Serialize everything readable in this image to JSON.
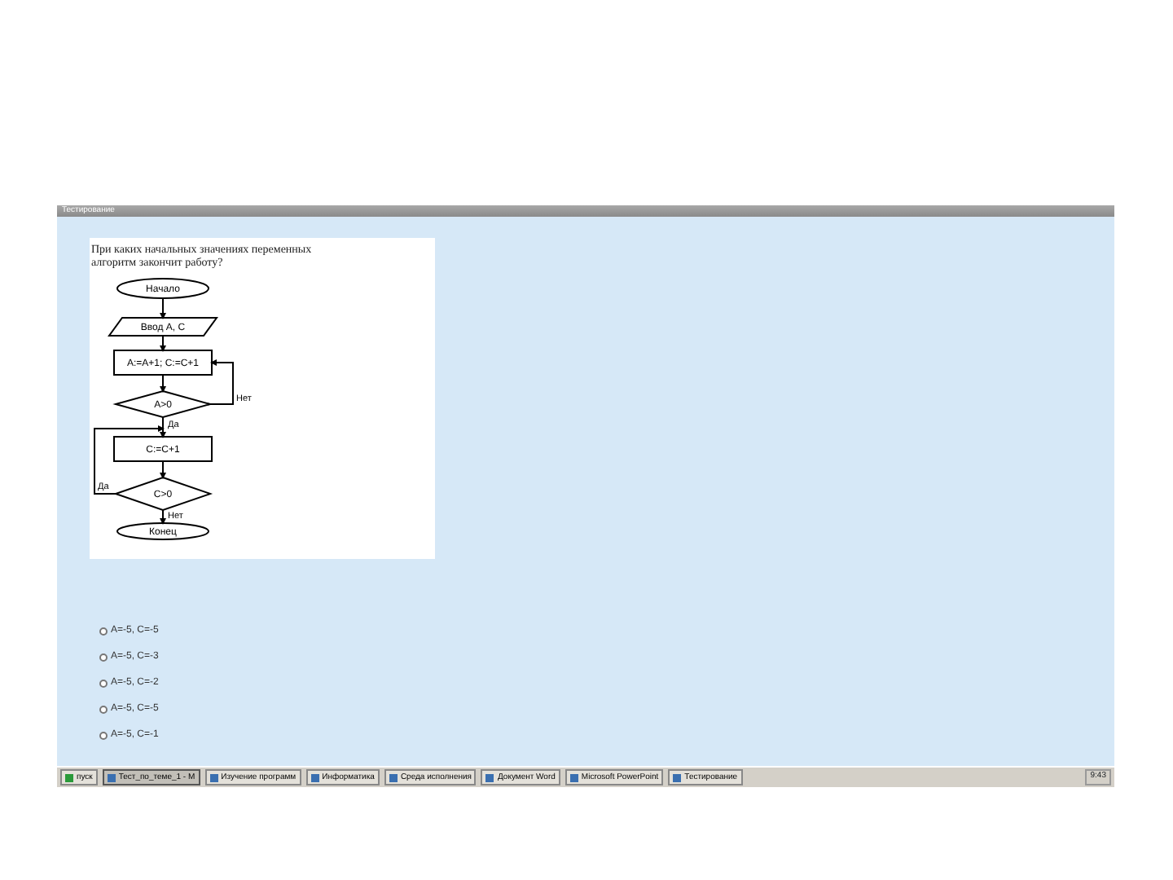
{
  "window": {
    "title": "Тестирование"
  },
  "question": {
    "text": "При каких начальных значениях переменных алгоритм закончит работу?",
    "flowchart": {
      "nodes": [
        {
          "kind": "terminal",
          "label": "Начало"
        },
        {
          "kind": "io",
          "label": "Ввод A, C"
        },
        {
          "kind": "process",
          "label": "A:=A+1;  C:=C+1"
        },
        {
          "kind": "decision",
          "label": "A>0"
        },
        {
          "kind": "process",
          "label": "C:=C+1"
        },
        {
          "kind": "decision",
          "label": "C>0"
        },
        {
          "kind": "terminal",
          "label": "Конец"
        }
      ],
      "edge_labels": [
        "Нет",
        "Да",
        "Да",
        "Нет"
      ]
    }
  },
  "options": [
    {
      "label": "A=-5, C=-5",
      "selected": false
    },
    {
      "label": "A=-5, C=-3",
      "selected": false
    },
    {
      "label": "A=-5, C=-2",
      "selected": false
    },
    {
      "label": "A=-5, C=-5",
      "selected": false
    },
    {
      "label": "A=-5, C=-1",
      "selected": false
    }
  ],
  "taskbar": {
    "start": "пуск",
    "items": [
      {
        "label": "Тест_по_теме_1 - М",
        "selected": true
      },
      {
        "label": "Изучение программ",
        "selected": false
      },
      {
        "label": "Информатика",
        "selected": false
      },
      {
        "label": "Среда исполнения",
        "selected": false
      },
      {
        "label": "Документ Word",
        "selected": false
      },
      {
        "label": "Microsoft PowerPoint",
        "selected": false
      },
      {
        "label": "Тестирование",
        "selected": false
      }
    ],
    "clock": "9:43"
  }
}
